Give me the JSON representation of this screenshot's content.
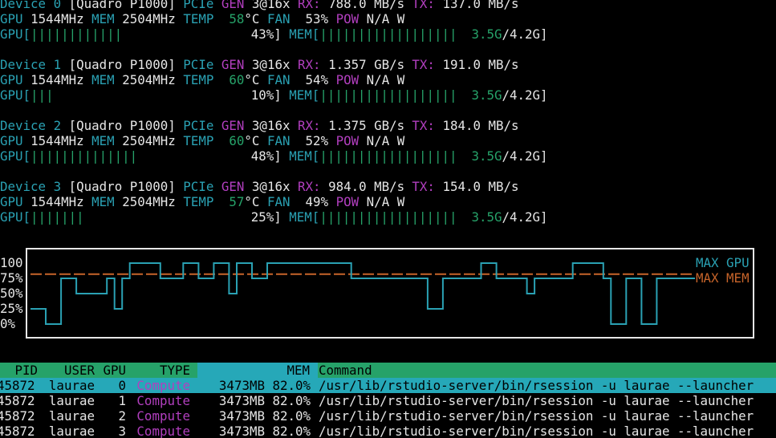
{
  "devices": [
    {
      "device_label": "Device",
      "index": "0",
      "model": "[Quadro P1000]",
      "pcie_label": "PCIe",
      "gen_label": "GEN",
      "gen_value": "3@16x",
      "rx_label": "RX:",
      "rx_value": "788.0 MB/s",
      "tx_label": "TX:",
      "tx_value": "137.0 MB/s",
      "gpu_label": "GPU",
      "gpu_clock": "1544MHz",
      "mem_label": "MEM",
      "mem_clock": "2504MHz",
      "temp_label": "TEMP",
      "temp_value": "58",
      "temp_unit": "°C",
      "fan_label": "FAN",
      "fan_value": "53%",
      "pow_label": "POW",
      "pow_value": "N/A W",
      "gpu_util_label": "GPU[",
      "gpu_util_bars": "||||||||||||",
      "gpu_util_percent": "43%]",
      "mem_util_label": "MEM[",
      "mem_util_bars": "||||||||||||||||||",
      "mem_used": "3.5G",
      "mem_total": "/4.2G]",
      "gpu_util": 0.43,
      "mem_util": 0.82
    },
    {
      "device_label": "Device",
      "index": "1",
      "model": "[Quadro P1000]",
      "pcie_label": "PCIe",
      "gen_label": "GEN",
      "gen_value": "3@16x",
      "rx_label": "RX:",
      "rx_value": "1.357 GB/s",
      "tx_label": "TX:",
      "tx_value": "191.0 MB/s",
      "gpu_label": "GPU",
      "gpu_clock": "1544MHz",
      "mem_label": "MEM",
      "mem_clock": "2504MHz",
      "temp_label": "TEMP",
      "temp_value": "60",
      "temp_unit": "°C",
      "fan_label": "FAN",
      "fan_value": "54%",
      "pow_label": "POW",
      "pow_value": "N/A W",
      "gpu_util_label": "GPU[",
      "gpu_util_bars": "|||",
      "gpu_util_percent": "10%]",
      "mem_util_label": "MEM[",
      "mem_util_bars": "||||||||||||||||||",
      "mem_used": "3.5G",
      "mem_total": "/4.2G]",
      "gpu_util": 0.1,
      "mem_util": 0.82
    },
    {
      "device_label": "Device",
      "index": "2",
      "model": "[Quadro P1000]",
      "pcie_label": "PCIe",
      "gen_label": "GEN",
      "gen_value": "3@16x",
      "rx_label": "RX:",
      "rx_value": "1.375 GB/s",
      "tx_label": "TX:",
      "tx_value": "184.0 MB/s",
      "gpu_label": "GPU",
      "gpu_clock": "1544MHz",
      "mem_label": "MEM",
      "mem_clock": "2504MHz",
      "temp_label": "TEMP",
      "temp_value": "60",
      "temp_unit": "°C",
      "fan_label": "FAN",
      "fan_value": "52%",
      "pow_label": "POW",
      "pow_value": "N/A W",
      "gpu_util_label": "GPU[",
      "gpu_util_bars": "||||||||||||||",
      "gpu_util_percent": "48%]",
      "mem_util_label": "MEM[",
      "mem_util_bars": "||||||||||||||||||",
      "mem_used": "3.5G",
      "mem_total": "/4.2G]",
      "gpu_util": 0.48,
      "mem_util": 0.82
    },
    {
      "device_label": "Device",
      "index": "3",
      "model": "[Quadro P1000]",
      "pcie_label": "PCIe",
      "gen_label": "GEN",
      "gen_value": "3@16x",
      "rx_label": "RX:",
      "rx_value": "984.0 MB/s",
      "tx_label": "TX:",
      "tx_value": "154.0 MB/s",
      "gpu_label": "GPU",
      "gpu_clock": "1544MHz",
      "mem_label": "MEM",
      "mem_clock": "2504MHz",
      "temp_label": "TEMP",
      "temp_value": "57",
      "temp_unit": "°C",
      "fan_label": "FAN",
      "fan_value": "49%",
      "pow_label": "POW",
      "pow_value": "N/A W",
      "gpu_util_label": "GPU[",
      "gpu_util_bars": "|||||||",
      "gpu_util_percent": "25%]",
      "mem_util_label": "MEM[",
      "mem_util_bars": "||||||||||||||||||",
      "mem_used": "3.5G",
      "mem_total": "/4.2G]",
      "gpu_util": 0.25,
      "mem_util": 0.82
    }
  ],
  "chart_data": {
    "type": "line",
    "yticks": [
      "100",
      "75%",
      "50%",
      "25%",
      "0%"
    ],
    "ylim": [
      0,
      100
    ],
    "legend_placement": "top-right",
    "series": [
      {
        "name": "MAX GPU",
        "color": "#2aa1b3",
        "values": [
          25,
          25,
          0,
          0,
          75,
          75,
          50,
          50,
          50,
          50,
          75,
          25,
          75,
          100,
          100,
          100,
          100,
          75,
          75,
          75,
          100,
          100,
          75,
          75,
          100,
          100,
          50,
          100,
          100,
          75,
          75,
          100,
          100,
          100,
          100,
          100,
          100,
          100,
          100,
          100,
          100,
          100,
          75,
          75,
          75,
          75,
          75,
          75,
          75,
          75,
          75,
          75,
          25,
          25,
          75,
          75,
          75,
          75,
          75,
          100,
          100,
          75,
          75,
          75,
          75,
          50,
          75,
          75,
          75,
          75,
          75,
          100,
          100,
          100,
          100,
          75,
          0,
          0,
          75,
          75,
          0,
          0,
          75,
          75,
          75,
          75,
          75
        ]
      },
      {
        "name": "MAX MEM",
        "color": "#c7642a",
        "values": [
          82,
          82,
          82,
          82,
          82,
          82,
          82,
          82,
          82,
          82,
          82,
          82,
          82,
          82,
          82,
          82,
          82,
          82,
          82,
          82,
          82,
          82,
          82,
          82,
          82,
          82,
          82,
          82,
          82,
          82,
          82,
          82,
          82,
          82,
          82,
          82,
          82,
          82,
          82,
          82,
          82,
          82,
          82,
          82,
          82,
          82,
          82,
          82,
          82,
          82,
          82,
          82,
          82,
          82,
          82,
          82,
          82,
          82,
          82,
          82,
          82,
          82,
          82,
          82,
          82,
          82,
          82,
          82,
          82,
          82,
          82,
          82,
          82,
          82,
          82,
          82,
          82,
          82,
          82,
          82,
          82,
          82,
          82,
          82,
          82,
          82,
          82
        ]
      }
    ]
  },
  "process_table": {
    "headers": {
      "pid": "PID",
      "user": "USER",
      "gpu": "GPU",
      "type": "TYPE",
      "mem": "MEM",
      "command": "Command"
    },
    "rows": [
      {
        "pid": "45872",
        "user": "laurae",
        "gpu": "0",
        "type": "Compute",
        "mem_mb": "3473MB",
        "mem_pct": "82.0%",
        "command": "/usr/lib/rstudio-server/bin/rsession -u laurae --launcher"
      },
      {
        "pid": "45872",
        "user": "laurae",
        "gpu": "1",
        "type": "Compute",
        "mem_mb": "3473MB",
        "mem_pct": "82.0%",
        "command": "/usr/lib/rstudio-server/bin/rsession -u laurae --launcher"
      },
      {
        "pid": "45872",
        "user": "laurae",
        "gpu": "2",
        "type": "Compute",
        "mem_mb": "3473MB",
        "mem_pct": "82.0%",
        "command": "/usr/lib/rstudio-server/bin/rsession -u laurae --launcher"
      },
      {
        "pid": "45872",
        "user": "laurae",
        "gpu": "3",
        "type": "Compute",
        "mem_mb": "3473MB",
        "mem_pct": "82.0%",
        "command": "/usr/lib/rstudio-server/bin/rsession -u laurae --launcher"
      }
    ]
  },
  "colors": {
    "background": "#000000",
    "label_cyan": "#2aa1b3",
    "label_magenta": "#b23fbf",
    "meter_green": "#26a269",
    "mem_line_orange": "#c7642a",
    "header_green": "#26a269",
    "header_cyan": "#26a8b8",
    "selected_row": "#26a8b8"
  }
}
